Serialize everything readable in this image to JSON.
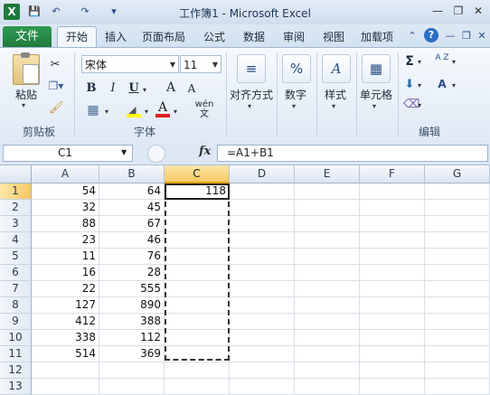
{
  "window": {
    "title": "工作簿1 - Microsoft Excel",
    "logo": "X",
    "quick_access": [
      "save-icon",
      "undo-icon",
      "redo-icon",
      "customize-icon"
    ],
    "controls": [
      "minimize-icon",
      "restore-icon",
      "close-icon"
    ],
    "accent": "#1f7a3c"
  },
  "tabs": {
    "file": "文件",
    "items": [
      "开始",
      "插入",
      "页面布局",
      "公式",
      "数据",
      "审阅",
      "视图",
      "加载项"
    ],
    "active": "开始"
  },
  "ribbon": {
    "clipboard": {
      "paste": "粘贴",
      "group": "剪贴板"
    },
    "font": {
      "name": "宋体",
      "size": "11",
      "bold": "B",
      "italic": "I",
      "underline": "U",
      "grow": "A",
      "shrink": "A",
      "font_color": "A",
      "phonetic": "wén 文",
      "group": "字体"
    },
    "alignment": {
      "label": "对齐方式"
    },
    "number": {
      "label": "数字",
      "symbol": "%"
    },
    "styles": {
      "label": "样式"
    },
    "cells": {
      "label": "单元格"
    },
    "editing": {
      "group": "编辑",
      "sum": "Σ",
      "sort": "A Z",
      "find": "A"
    }
  },
  "formula_bar": {
    "name_box": "C1",
    "fx": "fx",
    "formula": "=A1+B1"
  },
  "sheet": {
    "columns": [
      "A",
      "B",
      "C",
      "D",
      "E",
      "F",
      "G"
    ],
    "rows": [
      {
        "n": "1",
        "a": "54",
        "b": "64",
        "c": "118"
      },
      {
        "n": "2",
        "a": "32",
        "b": "45",
        "c": ""
      },
      {
        "n": "3",
        "a": "88",
        "b": "67",
        "c": ""
      },
      {
        "n": "4",
        "a": "23",
        "b": "46",
        "c": ""
      },
      {
        "n": "5",
        "a": "11",
        "b": "76",
        "c": ""
      },
      {
        "n": "6",
        "a": "16",
        "b": "28",
        "c": ""
      },
      {
        "n": "7",
        "a": "22",
        "b": "555",
        "c": ""
      },
      {
        "n": "8",
        "a": "127",
        "b": "890",
        "c": ""
      },
      {
        "n": "9",
        "a": "412",
        "b": "388",
        "c": ""
      },
      {
        "n": "10",
        "a": "338",
        "b": "112",
        "c": ""
      },
      {
        "n": "11",
        "a": "514",
        "b": "369",
        "c": ""
      },
      {
        "n": "12",
        "a": "",
        "b": "",
        "c": ""
      },
      {
        "n": "13",
        "a": "",
        "b": "",
        "c": ""
      }
    ],
    "selected_column": "C",
    "selected_row": "1",
    "selection_color": "#f5c863"
  }
}
